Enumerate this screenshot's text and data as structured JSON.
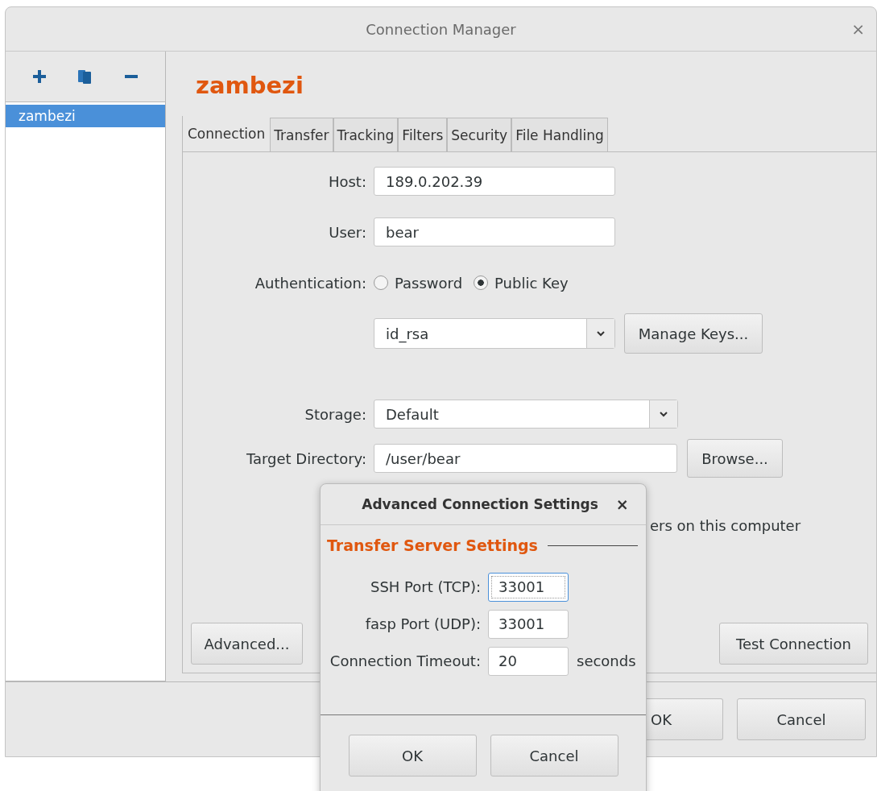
{
  "window": {
    "title": "Connection Manager",
    "close": "×"
  },
  "sidebar": {
    "items": [
      {
        "label": "zambezi",
        "selected": true
      }
    ]
  },
  "connection_name": "zambezi",
  "tabs": [
    {
      "label": "Connection",
      "selected": true
    },
    {
      "label": "Transfer",
      "selected": false
    },
    {
      "label": "Tracking",
      "selected": false
    },
    {
      "label": "Filters",
      "selected": false
    },
    {
      "label": "Security",
      "selected": false
    },
    {
      "label": "File Handling",
      "selected": false
    }
  ],
  "form": {
    "host_label": "Host:",
    "host": "189.0.202.39",
    "user_label": "User:",
    "user": "bear",
    "auth_label": "Authentication:",
    "auth_options": [
      {
        "label": "Password",
        "selected": false
      },
      {
        "label": "Public Key",
        "selected": true
      }
    ],
    "key": "id_rsa",
    "manage_keys": "Manage Keys...",
    "storage_label": "Storage:",
    "storage": "Default",
    "target_label": "Target Directory:",
    "target": "/user/bear",
    "browse": "Browse...",
    "partial_option": "ers on this computer",
    "advanced": "Advanced...",
    "test": "Test Connection"
  },
  "buttons": [
    "OK",
    "Cancel"
  ],
  "dialog": {
    "title": "Advanced Connection Settings",
    "close": "×",
    "section": "Transfer Server Settings",
    "fields": [
      {
        "label": "SSH Port (TCP):",
        "value": "33001",
        "focused": true
      },
      {
        "label": "fasp Port (UDP):",
        "value": "33001",
        "focused": false
      },
      {
        "label": "Connection Timeout:",
        "value": "20",
        "focused": false,
        "unit": "seconds"
      }
    ],
    "buttons": [
      "OK",
      "Cancel"
    ]
  }
}
